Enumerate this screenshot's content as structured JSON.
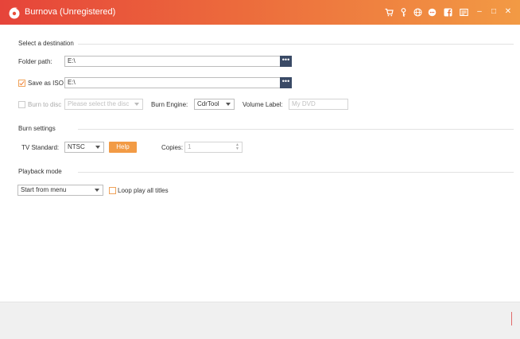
{
  "window": {
    "title": "Burnova (Unregistered)",
    "toolbar_icons": [
      "cart-icon",
      "key-icon",
      "globe-icon",
      "facebook-icon",
      "feedback-icon",
      "menu-icon",
      "minimize-icon",
      "maximize-icon",
      "close-icon"
    ],
    "window_buttons": {
      "minimize": "–",
      "maximize": "□",
      "close": "✕"
    }
  },
  "destination": {
    "section_title": "Select a destination",
    "folder_path_label": "Folder path:",
    "folder_path_value": "E:\\",
    "save_iso_label": "Save as ISO",
    "save_iso_checked": true,
    "save_iso_value": "E:\\",
    "browse_label": "•••",
    "burn_to_disc_label": "Burn to disc",
    "burn_to_disc_checked": false,
    "disc_placeholder": "Please select the disc",
    "burn_engine_label": "Burn Engine:",
    "burn_engine_value": "CdrTool",
    "volume_label": "Volume Label:",
    "volume_placeholder": "My DVD"
  },
  "burn_settings": {
    "section_title": "Burn settings",
    "tv_standard_label": "TV Standard:",
    "tv_standard_value": "NTSC",
    "help_label": "Help",
    "copies_label": "Copies:",
    "copies_value": "1"
  },
  "playback": {
    "section_title": "Playback mode",
    "mode_value": "Start from menu",
    "loop_label": "Loop play all titles",
    "loop_checked": false
  },
  "colors": {
    "titlebar_start": "#e6443a",
    "titlebar_end": "#f29a44",
    "accent": "#f29b45",
    "browse_button": "#3a4a66"
  }
}
